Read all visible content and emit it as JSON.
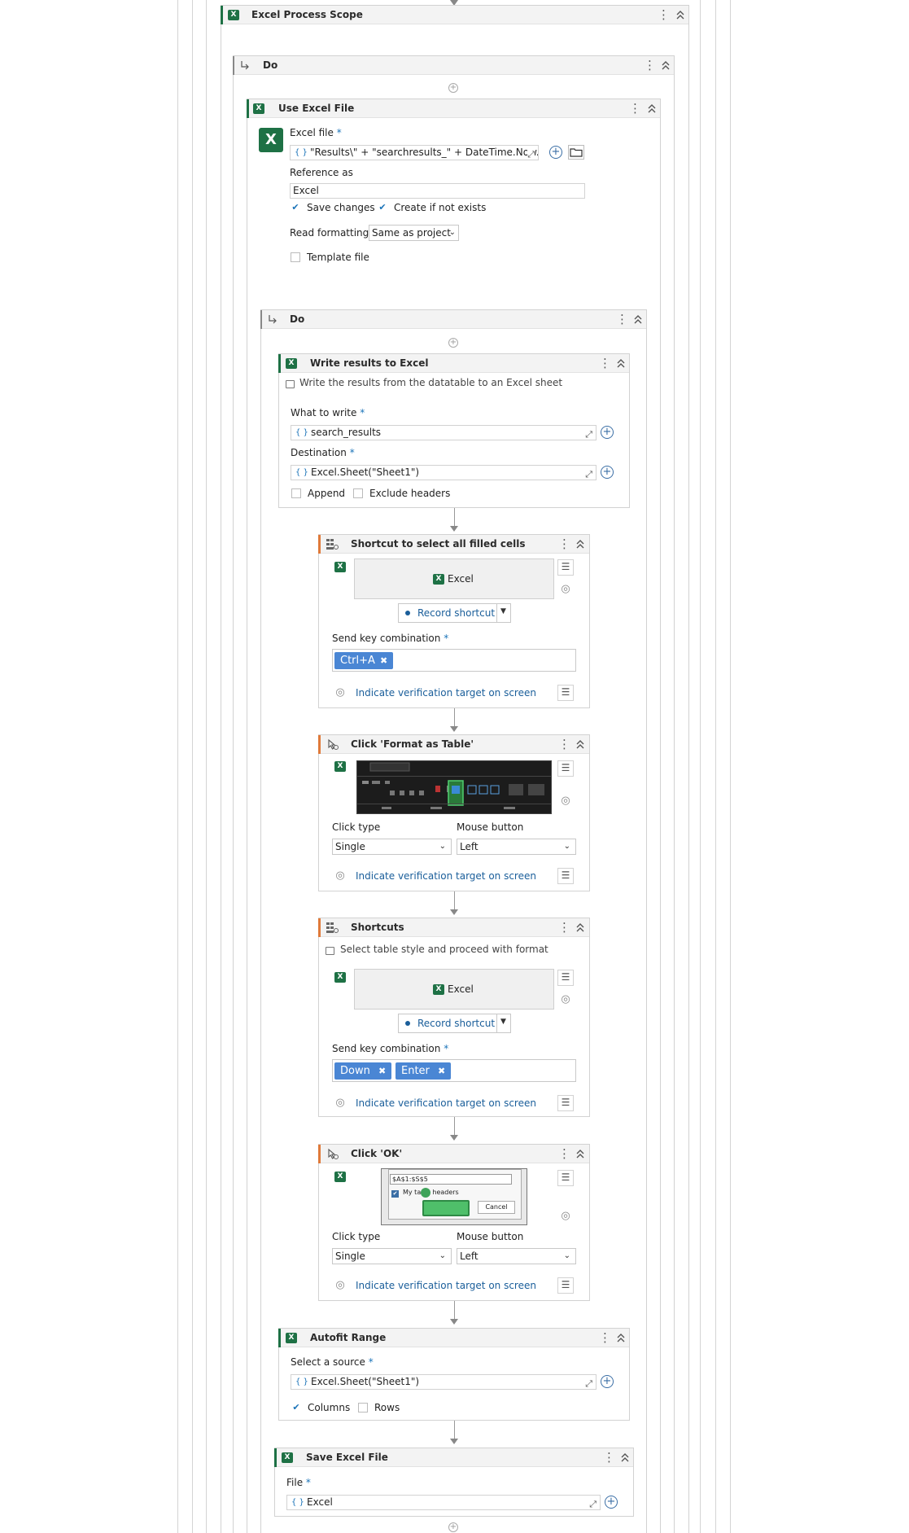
{
  "excel_process_scope": {
    "title": "Excel Process Scope"
  },
  "do_outer": {
    "title": "Do"
  },
  "use_excel_file": {
    "title": "Use Excel File",
    "excel_file_label": "Excel file",
    "excel_file_value": "\"Results\\\" + \"searchresults_\" + DateTime.Now.To",
    "reference_label": "Reference as",
    "reference_value": "Excel",
    "save_changes": "Save changes",
    "create_if_not_exists": "Create if not exists",
    "read_formatting_label": "Read formatting",
    "read_formatting_value": "Same as project",
    "template_file": "Template file"
  },
  "do_inner": {
    "title": "Do"
  },
  "write_results": {
    "title": "Write results to Excel",
    "annotation": "Write the results from the datatable to an Excel sheet",
    "what_label": "What to write",
    "what_value": "search_results",
    "dest_label": "Destination",
    "dest_value": "Excel.Sheet(\"Sheet1\")",
    "append": "Append",
    "exclude_headers": "Exclude headers"
  },
  "shortcut_select": {
    "title": "Shortcut to select all filled cells",
    "app": "Excel",
    "record": "Record shortcut",
    "send_key_label": "Send key combination",
    "keys": [
      "Ctrl+A"
    ],
    "verify": "Indicate verification target on screen"
  },
  "click_format": {
    "title": "Click 'Format as Table'",
    "click_type_label": "Click type",
    "click_type_value": "Single",
    "mouse_button_label": "Mouse button",
    "mouse_button_value": "Left",
    "verify": "Indicate verification target on screen"
  },
  "shortcuts": {
    "title": "Shortcuts",
    "annotation": "Select table style and proceed with format",
    "app": "Excel",
    "record": "Record shortcut",
    "send_key_label": "Send key combination",
    "keys": [
      "Down",
      "Enter"
    ],
    "verify": "Indicate verification target on screen"
  },
  "click_ok": {
    "title": "Click 'OK'",
    "shot_range": "$A$1:$S$5",
    "shot_headers": "My ta   as headers",
    "shot_cancel": "Cancel",
    "click_type_label": "Click type",
    "click_type_value": "Single",
    "mouse_button_label": "Mouse button",
    "mouse_button_value": "Left",
    "verify": "Indicate verification target on screen"
  },
  "autofit": {
    "title": "Autofit Range",
    "source_label": "Select a source",
    "source_value": "Excel.Sheet(\"Sheet1\")",
    "columns": "Columns",
    "rows": "Rows"
  },
  "save_excel": {
    "title": "Save Excel File",
    "file_label": "File",
    "file_value": "Excel"
  },
  "icons": {
    "kebab": "⋮",
    "collapse": "⌃",
    "expand": "⤢",
    "plus": "+",
    "check": "✔",
    "menu": "☰",
    "remove": "✖"
  },
  "colors": {
    "excel_green": "#1e7145",
    "link_blue": "#1a5e9a",
    "tag_blue": "#4a86d4",
    "ui_accent": "#e07a3a"
  }
}
